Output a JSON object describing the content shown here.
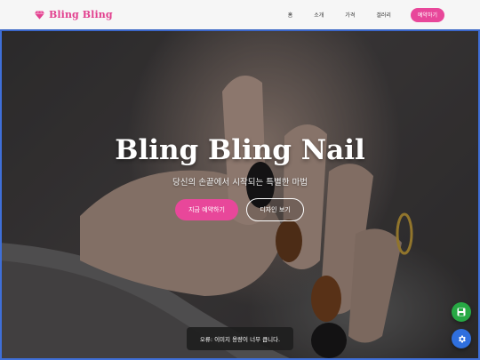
{
  "brand": {
    "name": "Bling Bling",
    "icon": "diamond-icon",
    "color": "#e2408f"
  },
  "nav": {
    "links": [
      "홈",
      "소개",
      "가격",
      "갤러리"
    ],
    "cta": "예약하기"
  },
  "hero": {
    "title": "Bling Bling Nail",
    "subtitle": "당신의 손끝에서 시작되는 특별한 마법",
    "primary_button": "지금 예약하기",
    "secondary_button": "디자인 보기"
  },
  "toast": {
    "message": "오류: 이미지 용량이 너무 큽니다."
  },
  "fabs": {
    "save_icon": "save-icon",
    "settings_icon": "gear-icon"
  },
  "colors": {
    "accent": "#e8479a",
    "save": "#27a844",
    "settings": "#2f6fde"
  }
}
